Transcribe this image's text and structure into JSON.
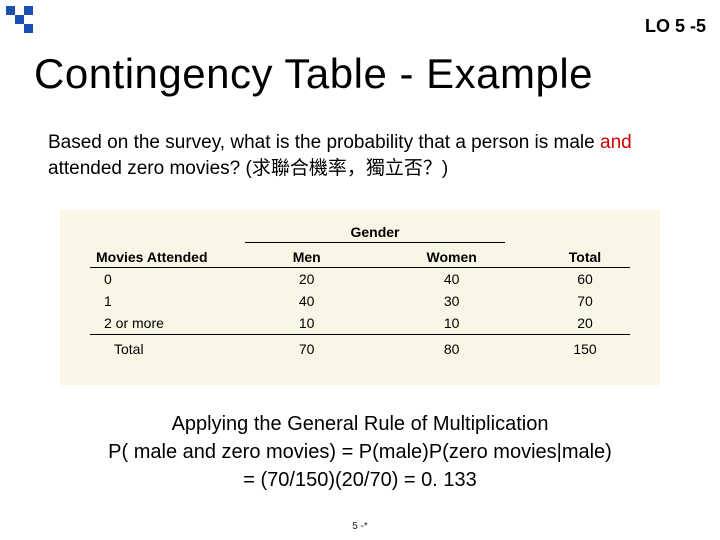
{
  "header": {
    "lo": "LO 5 -5"
  },
  "title": "Contingency Table - Example",
  "question": {
    "prefix": "Based on the survey, what is the probability that a person is male ",
    "highlight": "and",
    "suffix": " attended zero movies? (求聯合機率，獨立否？)"
  },
  "table": {
    "gender_header": "Gender",
    "col_rowhead": "Movies Attended",
    "col_men": "Men",
    "col_women": "Women",
    "col_total": "Total",
    "rows": [
      {
        "label": "0",
        "men": "20",
        "women": "40",
        "total": "60"
      },
      {
        "label": "1",
        "men": "40",
        "women": "30",
        "total": "70"
      },
      {
        "label": "2 or more",
        "men": "10",
        "women": "10",
        "total": "20"
      }
    ],
    "total_row": {
      "label": "Total",
      "men": "70",
      "women": "80",
      "total": "150"
    }
  },
  "answer": {
    "line1": "Applying the General Rule of Multiplication",
    "line2": "P( male and zero movies) = P(male)P(zero movies|male)",
    "line3": "= (70/150)(20/70) =  0. 133"
  },
  "footer": "5 -*",
  "chart_data": {
    "type": "table",
    "title": "Movies Attended by Gender (contingency table)",
    "row_variable": "Movies Attended",
    "col_variable": "Gender",
    "categories_rows": [
      "0",
      "1",
      "2 or more"
    ],
    "categories_cols": [
      "Men",
      "Women"
    ],
    "values": [
      [
        20,
        40
      ],
      [
        40,
        30
      ],
      [
        10,
        10
      ]
    ],
    "row_totals": [
      60,
      70,
      20
    ],
    "col_totals": [
      70,
      80
    ],
    "grand_total": 150
  }
}
